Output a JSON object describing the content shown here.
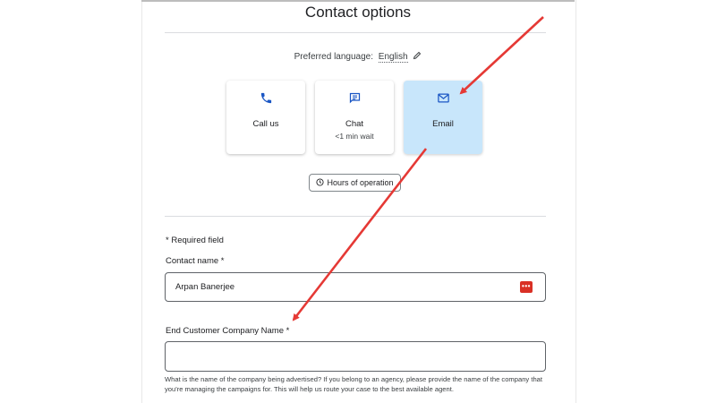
{
  "page": {
    "title": "Contact options",
    "preferred_language_label": "Preferred language:",
    "preferred_language_value": "English"
  },
  "contact_cards": [
    {
      "label": "Call us",
      "sub": "",
      "icon": "phone-icon",
      "selected": false
    },
    {
      "label": "Chat",
      "sub": "<1 min wait",
      "icon": "chat-icon",
      "selected": false
    },
    {
      "label": "Email",
      "sub": "",
      "icon": "email-icon",
      "selected": true
    }
  ],
  "hours_button": {
    "label": "Hours of operation",
    "icon": "clock-icon"
  },
  "form": {
    "required_note": "* Required field",
    "contact_name_label": "Contact name *",
    "contact_name_value": "Arpan Banerjee",
    "password_manager_icon": "password-manager-icon",
    "company_label": "End Customer Company Name *",
    "company_value": "",
    "company_help": "What is the name of the company being advertised? If you belong to an agency, please provide the name of the company that you're managing the campaigns for. This will help us route your case to the best available agent."
  },
  "colors": {
    "accent_blue": "#1a73e8",
    "selected_card": "#c8e6fb",
    "annotation_arrow": "#e53935"
  }
}
